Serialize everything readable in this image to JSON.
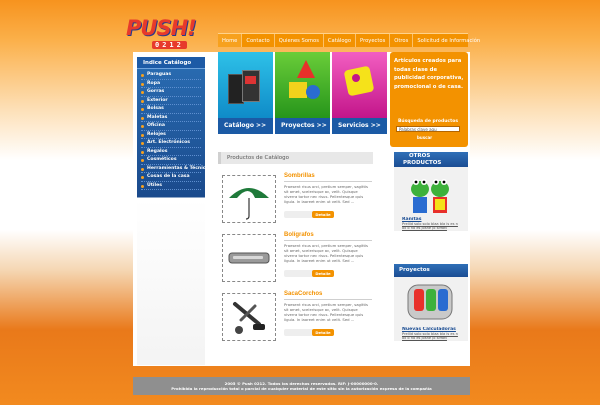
{
  "brand": {
    "name": "PUSH!",
    "sub": "0212"
  },
  "nav": [
    "Home",
    "Contacto",
    "Quienes Somos",
    "Catálogo",
    "Proyectos",
    "Otros",
    "Solicitud de Información"
  ],
  "sidebar": {
    "title": "Indice Catálogo",
    "items": [
      "Paraguas",
      "Ropa",
      "Gorras",
      "Exterior",
      "Bolsas",
      "Maletas",
      "Oficina",
      "Relojes",
      "Art. Electrónicos",
      "Regalos",
      "Cosméticos",
      "Herramientas & Técnica",
      "Cosas de la casa",
      "Útiles"
    ]
  },
  "features": [
    {
      "label": "Catálogo >>",
      "color": "#0f8bc8"
    },
    {
      "label": "Proyectos >>",
      "color": "#26951b"
    },
    {
      "label": "Servicios >>",
      "color": "#c3158a"
    }
  ],
  "promo": {
    "text": "Artículos creados para todas clase de publicidad corporativa, promocional o de casa.",
    "search_label": "Búsqueda de productos",
    "search_value": "Palabras clave aqu",
    "search_button": "buscar"
  },
  "catalog": {
    "title": "Productos de Catálogo",
    "products": [
      {
        "name": "Sombrillas",
        "desc": "Praesent risus orci, pretium semper, sagittis sit amet, scelerisque ac, velit. Quisque viverra tortor nec risus. Pellentesque quis ligula. In laoreet enim ut velit. Sed ...",
        "button": "Detalle",
        "icon": "umbrella-icon"
      },
      {
        "name": "Bolígrafos",
        "desc": "Praesent risus orci, pretium semper, sagittis sit amet, scelerisque ac, velit. Quisque viverra tortor nec risus. Pellentesque quis ligula. In laoreet enim ut velit. Sed ...",
        "button": "Detalle",
        "icon": "pen-case-icon"
      },
      {
        "name": "SacaCorchos",
        "desc": "Praesent risus orci, pretium semper, sagittis sit amet, scelerisque ac, velit. Quisque viverra tortor nec risus. Pellentesque quis ligula. In laoreet enim ut velit. Sed ...",
        "button": "Detalle",
        "icon": "corkscrew-icon"
      }
    ]
  },
  "otros": {
    "title_line1": "OTROS",
    "title_line2": "PRODUCTOS",
    "item_title": "Ranitas",
    "item_desc": "Prellid solo solo blaa bla is es n ox o no es joshe jo siffatt"
  },
  "proyectos": {
    "title": "Proyectos",
    "item_title": "Nuevas Calculadoras",
    "item_desc": "Prellid solo solo blaa bla is es n ox o no es joshe jo siffatt"
  },
  "footer": {
    "line1": "2005 © Push 0212. Todos los derechos reservados. RIF: J-00000000-0.",
    "line2": "Prohibida la reproducción total o parcial de cualquier material de este sitio sin la autorización expresa de la compañía"
  }
}
